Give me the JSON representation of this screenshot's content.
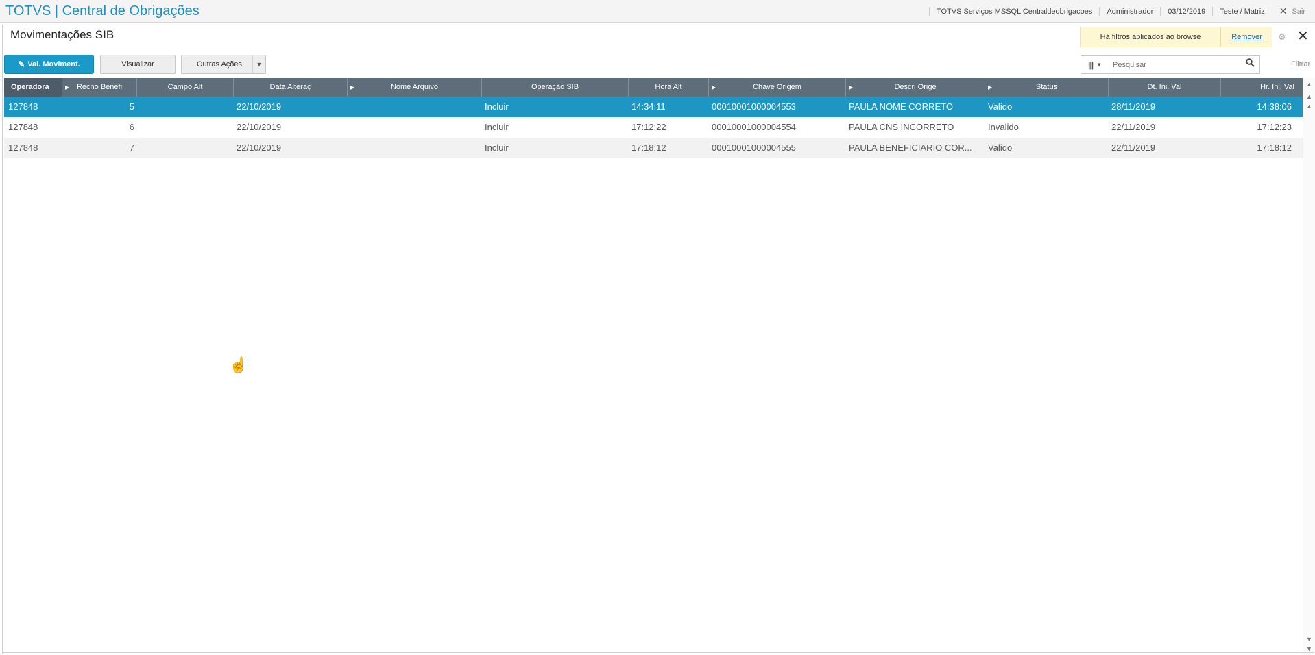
{
  "topbar": {
    "app_title": "TOTVS | Central de Obrigações",
    "environment": "TOTVS Serviços MSSQL Centraldeobrigacoes",
    "user": "Administrador",
    "date": "03/12/2019",
    "company": "Teste / Matriz",
    "exit_label": "Sair"
  },
  "page": {
    "title": "Movimentações SIB",
    "filter_notice": "Há filtros aplicados ao browse",
    "remove_link": "Remover"
  },
  "toolbar": {
    "primary_label": "Val. Moviment.",
    "view_label": "Visualizar",
    "other_actions_label": "Outras Ações"
  },
  "search": {
    "placeholder": "Pesquisar",
    "filter_label": "Filtrar"
  },
  "grid": {
    "columns": [
      "Operadora",
      "Recno Benefi",
      "Campo Alt",
      "Data Alteraç",
      "Nome Arquivo",
      "Operação SIB",
      "Hora Alt",
      "Chave Origem",
      "Descri Orige",
      "Status",
      "Dt. Ini. Val",
      "Hr. Ini. Val"
    ],
    "rows": [
      [
        "127848",
        "5",
        "",
        "22/10/2019",
        "",
        "Incluir",
        "14:34:11",
        "00010001000004553",
        "PAULA NOME CORRETO",
        "Valido",
        "28/11/2019",
        "14:38:06"
      ],
      [
        "127848",
        "6",
        "",
        "22/10/2019",
        "",
        "Incluir",
        "17:12:22",
        "00010001000004554",
        "PAULA CNS INCORRETO",
        "Invalido",
        "22/11/2019",
        "17:12:23"
      ],
      [
        "127848",
        "7",
        "",
        "22/10/2019",
        "",
        "Incluir",
        "17:18:12",
        "00010001000004555",
        "PAULA BENEFICIARIO COR...",
        "Valido",
        "22/11/2019",
        "17:18:12"
      ]
    ]
  }
}
